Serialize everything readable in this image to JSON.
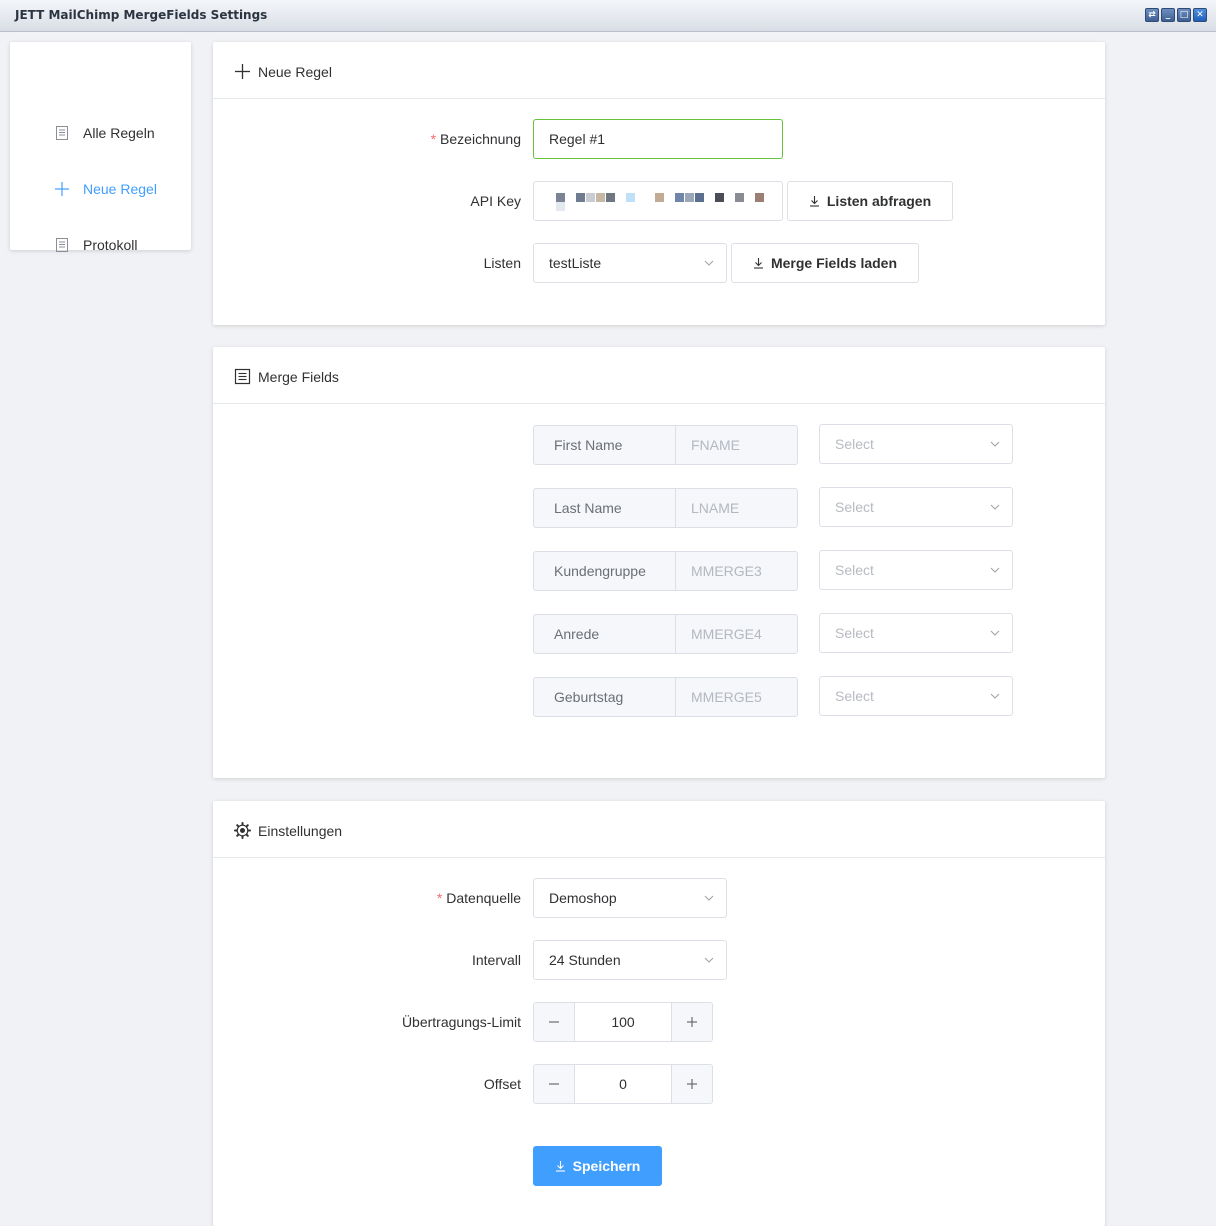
{
  "window": {
    "title": "JETT MailChimp MergeFields Settings"
  },
  "sidebar": {
    "items": [
      {
        "label": "Alle Regeln",
        "icon": "document-icon"
      },
      {
        "label": "Neue Regel",
        "icon": "plus-icon",
        "active": true
      },
      {
        "label": "Protokoll",
        "icon": "document-icon"
      }
    ]
  },
  "rule_card": {
    "title": "Neue Regel",
    "name_label": "Bezeichnung",
    "name_value": "Regel #1",
    "apikey_label": "API Key",
    "fetch_lists_button": "Listen abfragen",
    "lists_label": "Listen",
    "lists_value": "testListe",
    "load_fields_button": "Merge Fields laden"
  },
  "merge_card": {
    "title": "Merge Fields",
    "fields": [
      {
        "name": "First Name",
        "tag": "FNAME",
        "select_placeholder": "Select"
      },
      {
        "name": "Last Name",
        "tag": "LNAME",
        "select_placeholder": "Select"
      },
      {
        "name": "Kundengruppe",
        "tag": "MMERGE3",
        "select_placeholder": "Select"
      },
      {
        "name": "Anrede",
        "tag": "MMERGE4",
        "select_placeholder": "Select"
      },
      {
        "name": "Geburtstag",
        "tag": "MMERGE5",
        "select_placeholder": "Select"
      }
    ]
  },
  "settings_card": {
    "title": "Einstellungen",
    "source_label": "Datenquelle",
    "source_value": "Demoshop",
    "interval_label": "Intervall",
    "interval_value": "24 Stunden",
    "limit_label": "Übertragungs-Limit",
    "limit_value": "100",
    "offset_label": "Offset",
    "offset_value": "0",
    "save_button": "Speichern"
  },
  "colors": {
    "accent": "#409eff",
    "required": "#f56c6c",
    "focus_border": "#67c23a"
  }
}
